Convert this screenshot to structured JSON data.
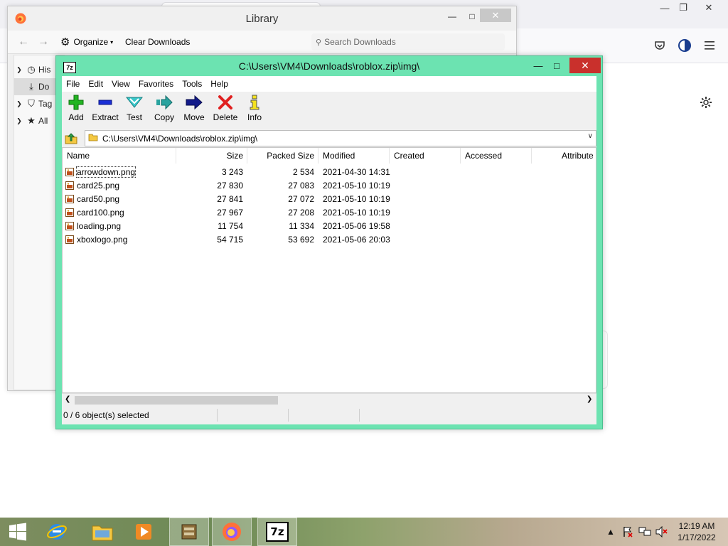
{
  "library": {
    "title": "Library",
    "toolbar": {
      "organize": "Organize",
      "clear_downloads": "Clear Downloads"
    },
    "search_placeholder": "Search Downloads",
    "sidebar": [
      "His",
      "Do",
      "Tag",
      "All"
    ]
  },
  "sevenzip": {
    "title": "C:\\Users\\VM4\\Downloads\\roblox.zip\\img\\",
    "menu": [
      "File",
      "Edit",
      "View",
      "Favorites",
      "Tools",
      "Help"
    ],
    "toolbar": [
      "Add",
      "Extract",
      "Test",
      "Copy",
      "Move",
      "Delete",
      "Info"
    ],
    "address": "C:\\Users\\VM4\\Downloads\\roblox.zip\\img\\",
    "columns": [
      "Name",
      "Size",
      "Packed Size",
      "Modified",
      "Created",
      "Accessed",
      "Attribute"
    ],
    "files": [
      {
        "name": "arrowdown.png",
        "size": "3 243",
        "packed": "2 534",
        "modified": "2021-04-30 14:31"
      },
      {
        "name": "card25.png",
        "size": "27 830",
        "packed": "27 083",
        "modified": "2021-05-10 10:19"
      },
      {
        "name": "card50.png",
        "size": "27 841",
        "packed": "27 072",
        "modified": "2021-05-10 10:19"
      },
      {
        "name": "card100.png",
        "size": "27 967",
        "packed": "27 208",
        "modified": "2021-05-10 10:19"
      },
      {
        "name": "loading.png",
        "size": "11 754",
        "packed": "11 334",
        "modified": "2021-05-06 19:58"
      },
      {
        "name": "xboxlogo.png",
        "size": "54 715",
        "packed": "53 692",
        "modified": "2021-05-06 20:03"
      }
    ],
    "status": "0 / 6 object(s) selected"
  },
  "taskbar": {
    "clock_time": "12:19 AM",
    "clock_date": "1/17/2022",
    "sevenzip_label": "7z"
  },
  "colors": {
    "sevenzip_frame": "#6ce3b1",
    "close_red": "#c9302c",
    "add_green": "#22b422",
    "delete_red": "#e02020"
  }
}
